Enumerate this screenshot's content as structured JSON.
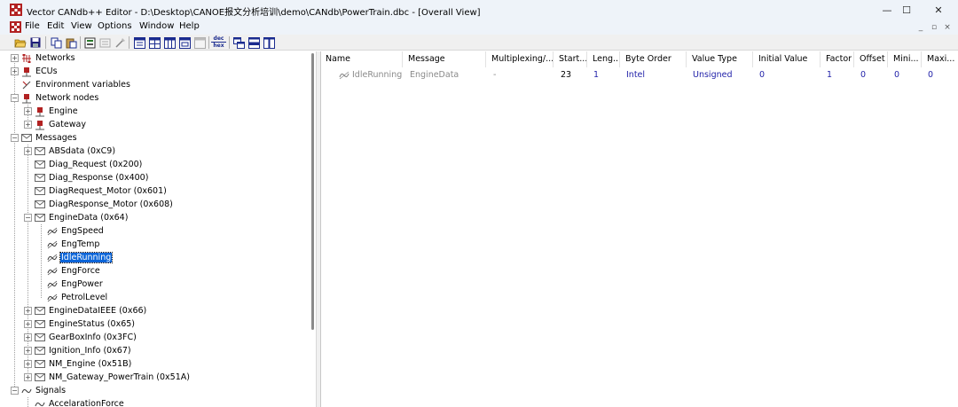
{
  "window": {
    "title": "Vector CANdb++ Editor - D:\\Desktop\\CANOE报文分析培训\\demo\\CANdb\\PowerTrain.dbc - [Overall View]",
    "minimize": "—",
    "maximize": "☐",
    "close": "✕"
  },
  "menu": {
    "file": "File",
    "edit": "Edit",
    "view": "View",
    "options": "Options",
    "window": "Window",
    "help": "Help",
    "mdi_min": "_",
    "mdi_restore": "▫",
    "mdi_close": "×"
  },
  "toolbar": {
    "hex_top": "dec",
    "hex_bottom": "hex"
  },
  "tree": {
    "networks": "Networks",
    "ecus": "ECUs",
    "env_vars": "Environment variables",
    "network_nodes": "Network nodes",
    "engine": "Engine",
    "gateway": "Gateway",
    "messages": "Messages",
    "msg_absdata": "ABSdata (0xC9)",
    "msg_diag_request": "Diag_Request (0x200)",
    "msg_diag_response": "Diag_Response (0x400)",
    "msg_diagrequest_motor": "DiagRequest_Motor (0x601)",
    "msg_diagresponse_motor": "DiagResponse_Motor (0x608)",
    "msg_enginedata": "EngineData (0x64)",
    "sig_engspeed": "EngSpeed",
    "sig_engtemp": "EngTemp",
    "sig_idlerunning": "IdleRunning",
    "sig_engforce": "EngForce",
    "sig_engpower": "EngPower",
    "sig_petrollevel": "PetrolLevel",
    "msg_enginedataieee": "EngineDataIEEE (0x66)",
    "msg_enginestatus": "EngineStatus (0x65)",
    "msg_gearboxinfo": "GearBoxInfo (0x3FC)",
    "msg_ignition_info": "Ignition_Info (0x67)",
    "msg_nm_engine": "NM_Engine (0x51B)",
    "msg_nm_gateway": "NM_Gateway_PowerTrain (0x51A)",
    "signals": "Signals",
    "sig_accelerationforce": "AccelarationForce"
  },
  "table": {
    "columns": [
      "Name",
      "Message",
      "Multiplexing/...",
      "Start...",
      "Leng...",
      "Byte Order",
      "Value Type",
      "Initial Value",
      "Factor",
      "Offset",
      "Mini...",
      "Maxi..."
    ],
    "row": {
      "name": "IdleRunning",
      "message": "EngineData",
      "multiplexing": "-",
      "start": "23",
      "length": "1",
      "byte_order": "Intel",
      "value_type": "Unsigned",
      "initial_value": "0",
      "factor": "1",
      "offset": "0",
      "minimum": "0",
      "maximum": "0"
    }
  },
  "icons": {
    "app": "candb-app-icon",
    "network": "network-icon",
    "ecu": "ecu-icon",
    "env": "env-var-icon",
    "node": "network-node-icon",
    "message": "message-envelope-icon",
    "signal": "signal-icon"
  },
  "colors": {
    "selection": "#0a64d8",
    "value_blue": "#1f1fa8",
    "gray_text": "#8a8a8a"
  }
}
